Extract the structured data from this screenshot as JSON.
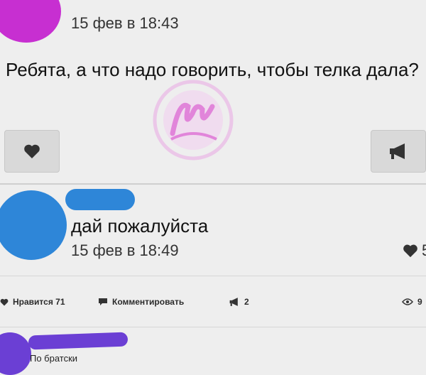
{
  "post": {
    "timestamp": "15 фев в 18:43",
    "text": "Ребята, а что надо говорить, чтобы телка дала?"
  },
  "comment": {
    "text": "дай пожалуйста",
    "timestamp": "15 фев в 18:49",
    "likes": "5"
  },
  "action_bar": {
    "like_label": "Нравится 71",
    "comment_label": "Комментировать",
    "repost_count": "2",
    "views": "9"
  },
  "bottom_comment": {
    "text": "По братски"
  },
  "colors": {
    "avatar_top": "#c72fd1",
    "avatar_comment": "#2e86d8",
    "avatar_bottom": "#6b3fd4",
    "watermark": "#e07ad8"
  },
  "icons": [
    "heart-icon",
    "megaphone-icon",
    "comment-icon",
    "eye-icon"
  ]
}
